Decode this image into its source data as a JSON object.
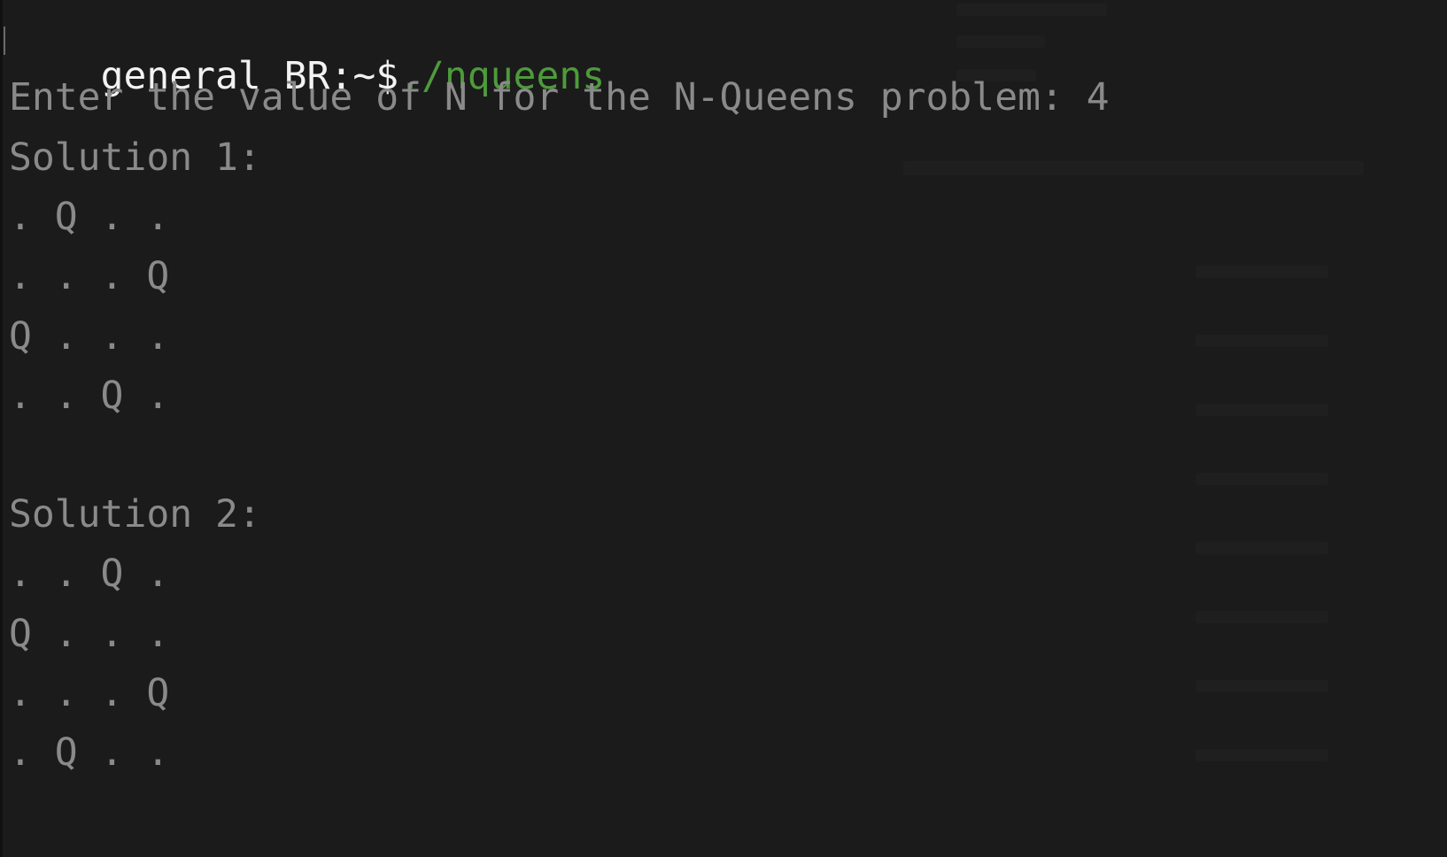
{
  "colors": {
    "background": "#1b1b1b",
    "prompt_text": "#f2f2f2",
    "command_text": "#4e9a3c",
    "output_text": "#8a8a8a"
  },
  "terminal": {
    "prompt": "general BR:~$",
    "command": "./nqueens",
    "input_prompt": "Enter the value of N for the N-Queens problem: 4",
    "solutions": [
      {
        "label": "Solution 1:",
        "rows": [
          ". Q . .",
          ". . . Q",
          "Q . . .",
          ". . Q ."
        ]
      },
      {
        "label": "Solution 2:",
        "rows": [
          ". . Q .",
          "Q . . .",
          ". . . Q",
          ". Q . ."
        ]
      }
    ]
  }
}
